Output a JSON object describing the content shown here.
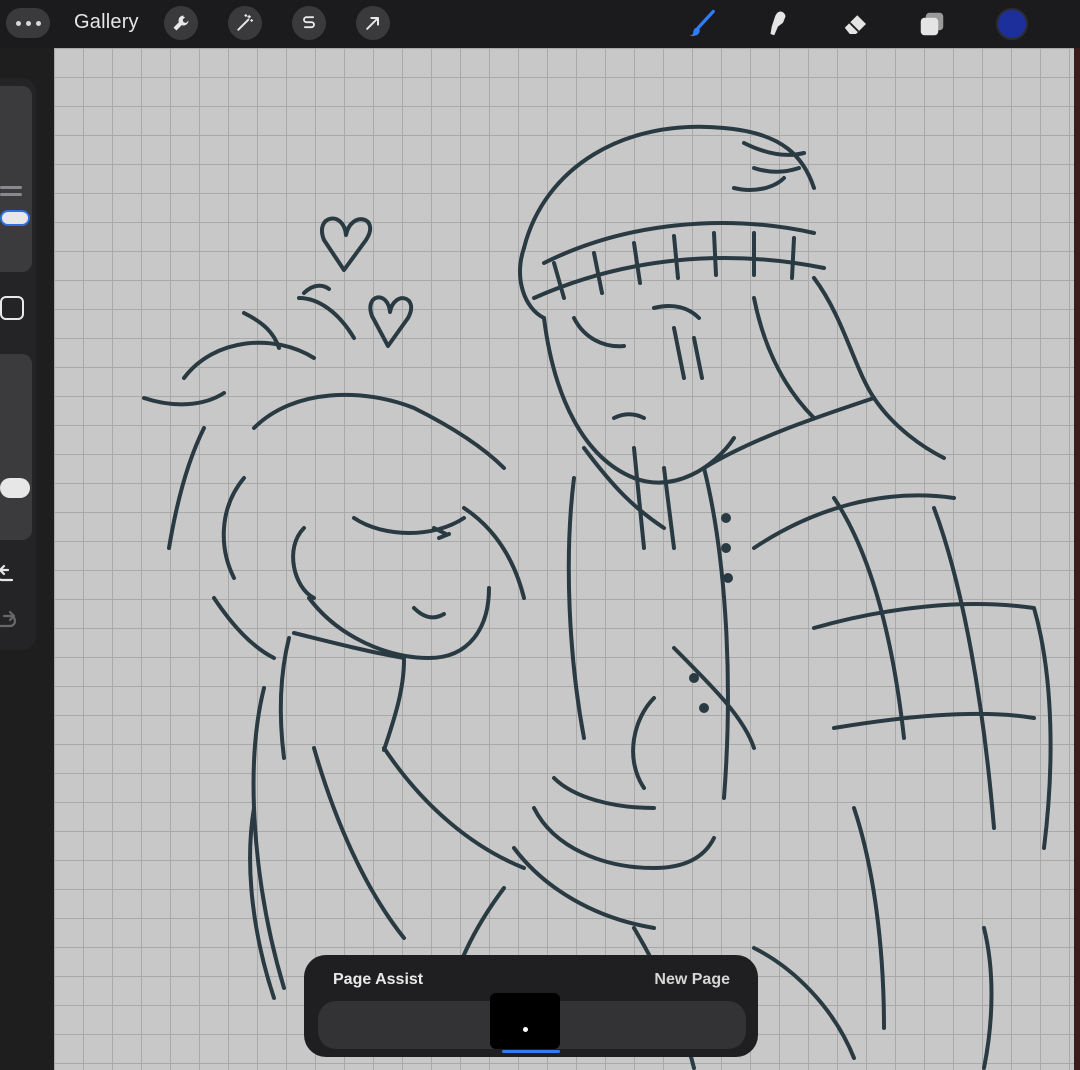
{
  "topbar": {
    "gallery_label": "Gallery",
    "left_tools": [
      {
        "icon": "wrench-icon",
        "name": "actions"
      },
      {
        "icon": "magic-wand-icon",
        "name": "adjustments"
      },
      {
        "icon": "selection-icon",
        "name": "selection"
      },
      {
        "icon": "transform-arrow-icon",
        "name": "transform"
      }
    ],
    "right_tools": [
      {
        "icon": "brush-icon",
        "name": "paint",
        "active": true
      },
      {
        "icon": "smudge-icon",
        "name": "smudge"
      },
      {
        "icon": "eraser-icon",
        "name": "erase"
      },
      {
        "icon": "layers-icon",
        "name": "layers"
      }
    ],
    "current_color": "#1d2f9a",
    "active_tool_color": "#2f7cf6"
  },
  "page_assist": {
    "title": "Page Assist",
    "new_page_label": "New Page"
  },
  "colors": {
    "canvas_bg": "#c8c8c8",
    "grid": "#a9a9a9",
    "ink": "#2a3a42"
  }
}
